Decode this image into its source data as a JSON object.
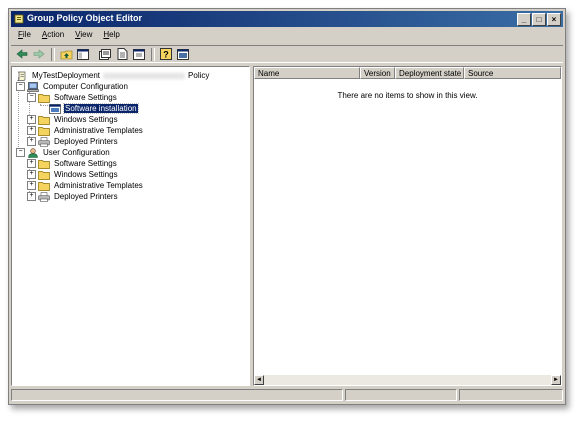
{
  "window": {
    "title": "Group Policy Object Editor",
    "controls": {
      "minimize": "_",
      "maximize": "□",
      "close": "×"
    }
  },
  "menu": [
    {
      "underline": "F",
      "rest": "ile"
    },
    {
      "underline": "A",
      "rest": "ction"
    },
    {
      "underline": "V",
      "rest": "iew"
    },
    {
      "underline": "H",
      "rest": "elp"
    }
  ],
  "toolbar": [
    {
      "name": "back-button",
      "icon": "back-arrow-icon"
    },
    {
      "name": "forward-button",
      "icon": "forward-arrow-icon"
    },
    {
      "name": "up-level-button",
      "icon": "up-folder-icon"
    },
    {
      "name": "show-hide-tree-button",
      "icon": "console-tree-icon"
    },
    {
      "name": "properties-button",
      "icon": "properties-icon"
    },
    {
      "name": "export-list-button",
      "icon": "export-list-icon"
    },
    {
      "name": "new-window-button",
      "icon": "new-window-icon"
    },
    {
      "name": "help-button",
      "icon": "help-icon"
    },
    {
      "name": "console-button",
      "icon": "console-icon"
    }
  ],
  "tree": {
    "root": {
      "label_start": "MyTestDeployment",
      "label_end": "Policy",
      "icon": "policy-scroll-icon"
    },
    "computer_config": {
      "label": "Computer Configuration",
      "icon": "computer-icon",
      "expander": "−",
      "children": [
        {
          "label": "Software Settings",
          "icon": "folder-icon",
          "expander": "−"
        },
        {
          "label": "Software installation",
          "icon": "software-installation-icon",
          "expander": "",
          "selected": true
        },
        {
          "label": "Windows Settings",
          "icon": "folder-icon",
          "expander": "+"
        },
        {
          "label": "Administrative Templates",
          "icon": "folder-icon",
          "expander": "+"
        },
        {
          "label": "Deployed Printers",
          "icon": "printer-icon",
          "expander": "+"
        }
      ]
    },
    "user_config": {
      "label": "User Configuration",
      "icon": "user-icon",
      "expander": "−",
      "children": [
        {
          "label": "Software Settings",
          "icon": "folder-icon",
          "expander": "+"
        },
        {
          "label": "Windows Settings",
          "icon": "folder-icon",
          "expander": "+"
        },
        {
          "label": "Administrative Templates",
          "icon": "folder-icon",
          "expander": "+"
        },
        {
          "label": "Deployed Printers",
          "icon": "printer-icon",
          "expander": "+"
        }
      ]
    }
  },
  "list": {
    "columns": [
      "Name",
      "Version",
      "Deployment state",
      "Source"
    ],
    "empty_message": "There are no items to show in this view.",
    "scroll_left": "◄",
    "scroll_right": "►"
  },
  "colors": {
    "titlebar": "#0a246a",
    "selection": "#0a246a",
    "chrome": "#d4d0c8"
  }
}
